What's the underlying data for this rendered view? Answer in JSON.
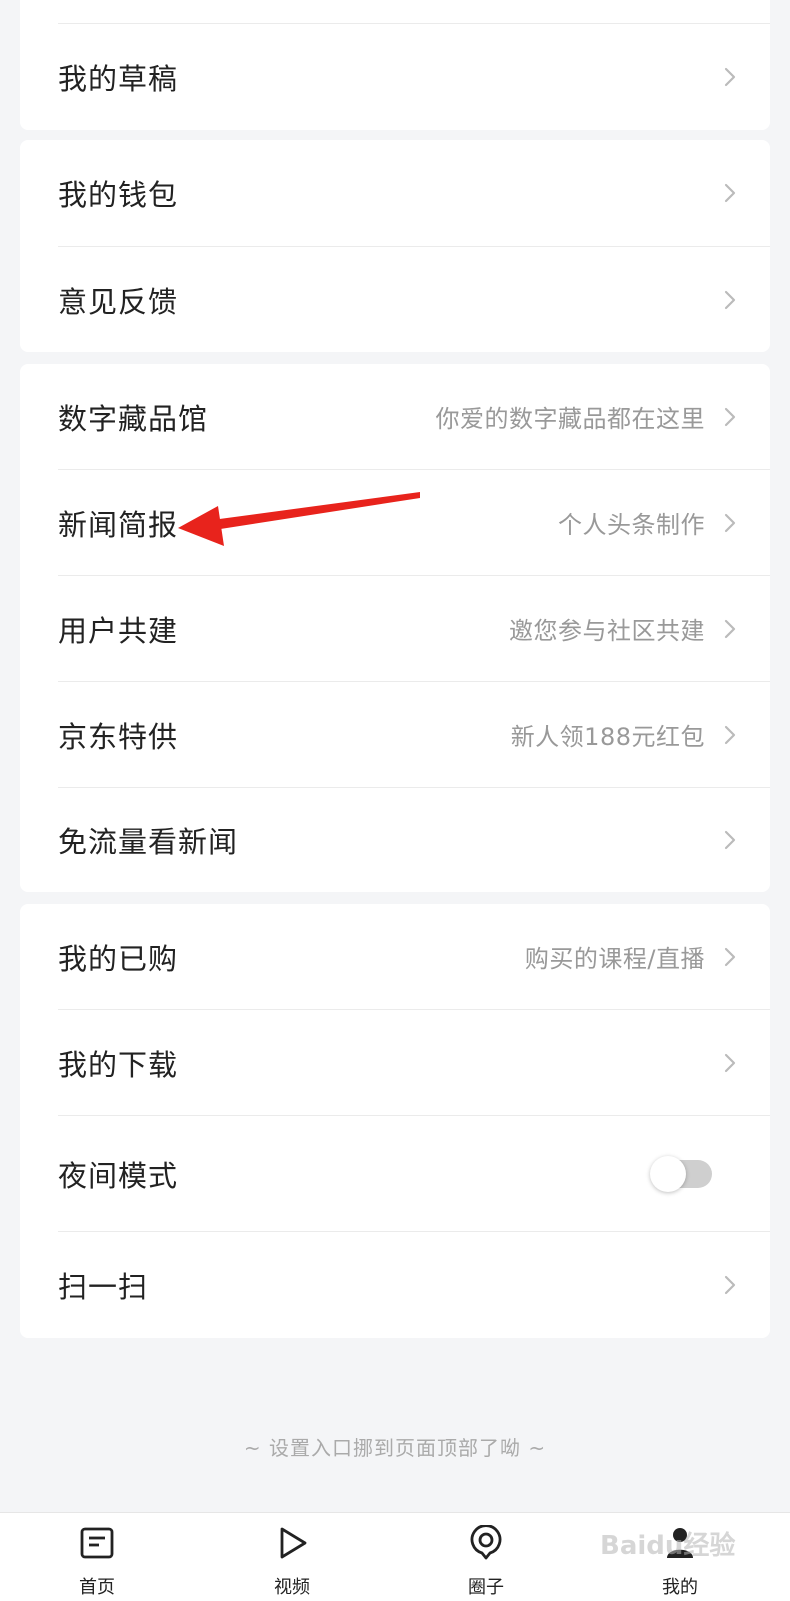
{
  "sections": [
    {
      "rows": [
        {
          "label": "我的草稿",
          "sub": ""
        }
      ]
    },
    {
      "rows": [
        {
          "label": "我的钱包",
          "sub": ""
        },
        {
          "label": "意见反馈",
          "sub": ""
        }
      ]
    },
    {
      "rows": [
        {
          "label": "数字藏品馆",
          "sub": "你爱的数字藏品都在这里"
        },
        {
          "label": "新闻简报",
          "sub": "个人头条制作"
        },
        {
          "label": "用户共建",
          "sub": "邀您参与社区共建"
        },
        {
          "label": "京东特供",
          "sub": "新人领188元红包"
        },
        {
          "label": "免流量看新闻",
          "sub": ""
        }
      ]
    },
    {
      "rows": [
        {
          "label": "我的已购",
          "sub": "购买的课程/直播"
        },
        {
          "label": "我的下载",
          "sub": ""
        },
        {
          "label": "夜间模式",
          "sub": "",
          "toggle": false
        },
        {
          "label": "扫一扫",
          "sub": ""
        }
      ]
    }
  ],
  "footer_note": "~ 设置入口挪到页面顶部了呦 ~",
  "tabbar": [
    {
      "label": "首页",
      "icon": "home-doc-icon"
    },
    {
      "label": "视频",
      "icon": "play-icon"
    },
    {
      "label": "圈子",
      "icon": "circle-location-icon"
    },
    {
      "label": "我的",
      "icon": "profile-icon"
    }
  ],
  "watermark": "Baidu经验",
  "colors": {
    "annotation_arrow": "#e8231c",
    "background": "#f4f5f7"
  }
}
